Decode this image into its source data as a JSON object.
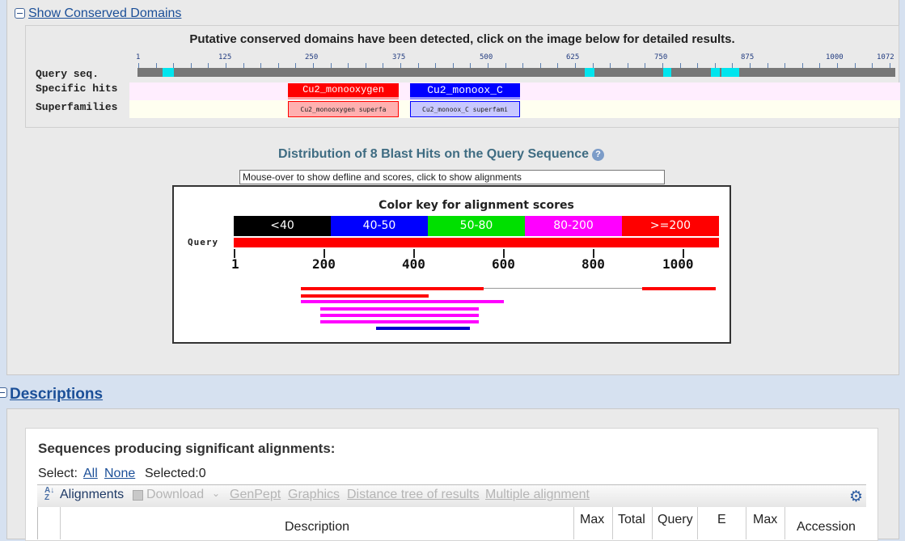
{
  "conserved": {
    "toggle_label": "Show Conserved Domains",
    "heading": "Putative conserved domains have been detected, click on the image below for detailed results.",
    "row_labels": [
      "Query seq.",
      "Specific hits",
      "Superfamilies"
    ],
    "ruler_ticks": [
      "1",
      "125",
      "250",
      "375",
      "500",
      "625",
      "750",
      "875",
      "1000",
      "1072"
    ],
    "specific_hits": [
      {
        "label": "Cu2_monooxygen",
        "color": "#ff0000"
      },
      {
        "label": "Cu2_monoox_C",
        "color": "#0000ff"
      }
    ],
    "superfamilies": [
      {
        "label": "Cu2_monooxygen superfa",
        "color": "#ffb0b0"
      },
      {
        "label": "Cu2_monoox_C superfami",
        "color": "#b0b0ff"
      }
    ]
  },
  "blast": {
    "title": "Distribution of 8 Blast Hits on the Query Sequence",
    "help_icon": "question-icon",
    "defline_box": "Mouse-over to show defline and scores, click to show alignments",
    "color_key_title": "Color key for alignment scores",
    "color_key": [
      {
        "label": "<40",
        "color": "#000000"
      },
      {
        "label": "40-50",
        "color": "#0000ff"
      },
      {
        "label": "50-80",
        "color": "#00e000"
      },
      {
        "label": "80-200",
        "color": "#ff00ff"
      },
      {
        "label": ">=200",
        "color": "#ff0000"
      }
    ],
    "query_label": "Query",
    "axis_labels": [
      "1",
      "200",
      "400",
      "600",
      "800",
      "1000"
    ]
  },
  "descriptions": {
    "toggle_label": "Descriptions",
    "heading": "Sequences producing significant alignments:",
    "select_label": "Select:",
    "select_all": "All",
    "select_none": "None",
    "selected_text": "Selected:0",
    "toolbar": {
      "alignments": "Alignments",
      "download": "Download",
      "genpept": "GenPept",
      "graphics": "Graphics",
      "distance_tree": "Distance tree of results",
      "multiple_alignment": "Multiple alignment",
      "settings_icon": "gear-icon"
    },
    "columns": [
      "Description",
      "Max",
      "Total",
      "Query",
      "E",
      "Max",
      "Accession"
    ]
  }
}
